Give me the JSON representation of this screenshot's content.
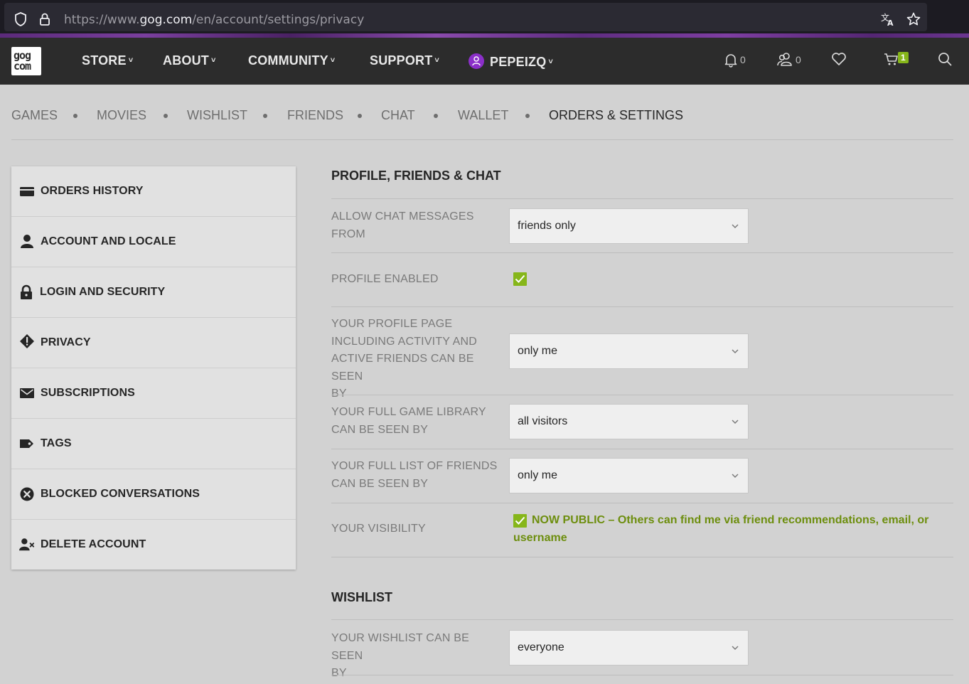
{
  "browser": {
    "url_prefix": "https://www.",
    "url_domain": "gog.com",
    "url_path": "/en/account/settings/privacy"
  },
  "nav": {
    "logo_line1": "gog",
    "logo_line2": "com",
    "store": "STORE",
    "about": "ABOUT",
    "community": "COMMUNITY",
    "support": "SUPPORT",
    "username": "PEPEIZQ",
    "notifications_count": "0",
    "friends_count": "0",
    "cart_count": "1"
  },
  "subnav": {
    "items": [
      "GAMES",
      "MOVIES",
      "WISHLIST",
      "FRIENDS",
      "CHAT",
      "WALLET",
      "ORDERS & SETTINGS"
    ],
    "active": "ORDERS & SETTINGS"
  },
  "sidebar": {
    "items": [
      {
        "label": "ORDERS HISTORY",
        "icon": "card-icon"
      },
      {
        "label": "ACCOUNT AND LOCALE",
        "icon": "user-icon"
      },
      {
        "label": "LOGIN AND SECURITY",
        "icon": "lock-icon"
      },
      {
        "label": "PRIVACY",
        "icon": "warning-diamond-icon"
      },
      {
        "label": "SUBSCRIPTIONS",
        "icon": "envelope-icon"
      },
      {
        "label": "TAGS",
        "icon": "tag-icon"
      },
      {
        "label": "BLOCKED CONVERSATIONS",
        "icon": "blocked-icon"
      },
      {
        "label": "DELETE ACCOUNT",
        "icon": "user-remove-icon"
      }
    ]
  },
  "settings": {
    "section1_title": "PROFILE, FRIENDS & CHAT",
    "chat_label_1": "ALLOW CHAT MESSAGES",
    "chat_label_2": "FROM",
    "chat_value": "friends only",
    "profile_enabled_label": "PROFILE ENABLED",
    "profile_enabled": true,
    "profile_page_label_1": "YOUR PROFILE PAGE",
    "profile_page_label_2": "INCLUDING ACTIVITY AND",
    "profile_page_label_3": "ACTIVE FRIENDS CAN BE SEEN",
    "profile_page_label_4": "BY",
    "profile_page_value": "only me",
    "library_label_1": "YOUR FULL GAME LIBRARY",
    "library_label_2": "CAN BE SEEN BY",
    "library_value": "all visitors",
    "friends_list_label_1": "YOUR FULL LIST OF FRIENDS",
    "friends_list_label_2": "CAN BE SEEN BY",
    "friends_list_value": "only me",
    "visibility_label": "YOUR VISIBILITY",
    "visibility_enabled": true,
    "visibility_status": "NOW PUBLIC",
    "visibility_desc_1": " – Others can find me via friend recommendations, email, or",
    "visibility_desc_2": "username",
    "section2_title": "WISHLIST",
    "wishlist_label_1": "YOUR WISHLIST CAN BE SEEN",
    "wishlist_label_2": "BY",
    "wishlist_value": "everyone"
  },
  "colors": {
    "accent_green": "#86b61a",
    "nav_bg": "#2c2c2c",
    "page_bg": "#d2d2d2",
    "avatar_purple": "#8b2fc9"
  }
}
